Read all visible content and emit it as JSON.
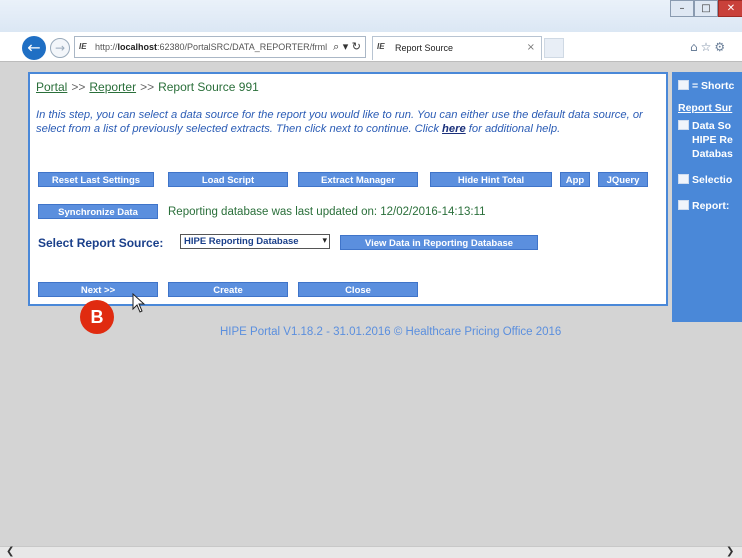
{
  "browser": {
    "address_prefix": "http://",
    "address_host": "localhost",
    "address_path": ":62380/PortalSRC/DATA_REPORTER/frml",
    "address_tools": "⌕ ▾ ↻",
    "tab_title": "Report Source",
    "tab_close": "×",
    "favicon": "IE",
    "back": "←",
    "forward": "→",
    "win_min": "–",
    "win_max": "□",
    "win_close": "✕",
    "toolbar_icons": "⌂☆⚙"
  },
  "breadcrumb": {
    "portal": "Portal",
    "sep1": ">>",
    "reporter": "Reporter",
    "sep2": ">>",
    "current": "Report Source 991"
  },
  "hint": {
    "text_before": "In this step, you can select a data source for the report you would like to run. You can either use the default data source, or select from a list of previously selected extracts. Then click next to continue. Click ",
    "link": "here",
    "text_after": " for additional help."
  },
  "toolbar": {
    "reset": "Reset Last Settings",
    "load_script": "Load Script",
    "extract_manager": "Extract Manager",
    "hide_hint": "Hide Hint Total",
    "app": "App",
    "jquery": "JQuery"
  },
  "sync": {
    "button": "Synchronize Data",
    "status": "Reporting database was last updated on: 12/02/2016-14:13:11"
  },
  "source": {
    "label": "Select Report Source:",
    "selected": "HIPE Reporting Database",
    "view_button": "View Data in Reporting Database"
  },
  "actions": {
    "next": "Next >>",
    "create": "Create",
    "close": "Close"
  },
  "marker": "B",
  "footer": "HIPE Portal V1.18.2 - 31.01.2016 © Healthcare Pricing Office 2016",
  "sidebar": {
    "shortcut": "= Shortc",
    "summary": "Report Sur",
    "data_source": "Data So",
    "data_source_l2": "HIPE Re",
    "data_source_l3": "Databas",
    "selection": "Selectio",
    "report": "Report:"
  },
  "scroll": {
    "left": "❮",
    "right": "❯"
  },
  "colors": {
    "accent": "#4a88d8",
    "button": "#5b8fde",
    "link_green": "#2a6f3a",
    "hint_blue": "#2b5cb5",
    "marker": "#e02b10"
  }
}
